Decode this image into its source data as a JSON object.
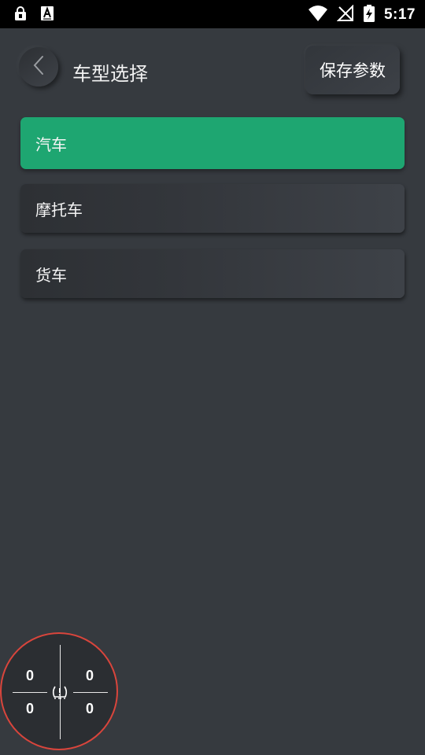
{
  "status_bar": {
    "time": "5:17",
    "icons": [
      "lock-icon",
      "keyboard-a-icon",
      "wifi-icon",
      "no-signal-icon",
      "battery-charging-icon"
    ]
  },
  "header": {
    "title": "车型选择",
    "save_label": "保存参数",
    "back_icon": "chevron-left-icon"
  },
  "vehicle_types": [
    {
      "label": "汽车",
      "selected": true
    },
    {
      "label": "摩托车",
      "selected": false
    },
    {
      "label": "货车",
      "selected": false
    }
  ],
  "tire_widget": {
    "front_left": "0",
    "front_right": "0",
    "rear_left": "0",
    "rear_right": "0",
    "icon": "tire-pressure-warning-icon",
    "ring_color": "#d9453c"
  },
  "colors": {
    "background": "#363a3f",
    "accent": "#1ea671",
    "status_bar": "#000000"
  }
}
